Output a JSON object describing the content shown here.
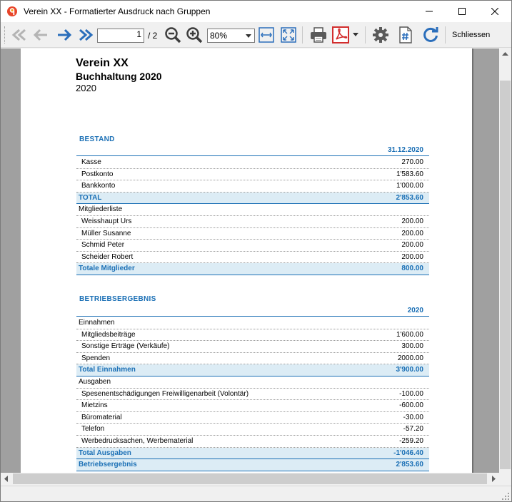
{
  "window": {
    "title": "Verein XX - Formatierter Ausdruck nach Gruppen"
  },
  "toolbar": {
    "page_current": "1",
    "page_total": "/ 2",
    "zoom": "80%",
    "close_label": "Schliessen"
  },
  "icons": {
    "first_page": "double-left-arrow",
    "prev_page": "left-arrow",
    "next_page": "right-arrow",
    "last_page": "double-right-arrow",
    "zoom_out": "zoom-out",
    "zoom_in": "zoom-in",
    "fit_width": "fit-width",
    "fit_page": "fit-page",
    "print": "printer",
    "pdf": "pdf",
    "settings": "gear",
    "page_numbers": "hash-document",
    "refresh": "refresh"
  },
  "colors": {
    "accent": "#1a6fb5",
    "total_bg": "#dcecf5",
    "pdf_red": "#d22d2d"
  },
  "report": {
    "title": "Verein XX",
    "subtitle": "Buchhaltung 2020",
    "year": "2020",
    "bestand": {
      "heading": "BESTAND",
      "column": "31.12.2020",
      "rows": [
        {
          "label": "Kasse",
          "value": "270.00",
          "kind": "item"
        },
        {
          "label": "Postkonto",
          "value": "1'583.60",
          "kind": "item"
        },
        {
          "label": "Bankkonto",
          "value": "1'000.00",
          "kind": "item"
        },
        {
          "label": "TOTAL",
          "value": "2'853.60",
          "kind": "total"
        },
        {
          "label": "Mitgliederliste",
          "value": "",
          "kind": "group"
        },
        {
          "label": "Weisshaupt Urs",
          "value": "200.00",
          "kind": "item"
        },
        {
          "label": "Müller Susanne",
          "value": "200.00",
          "kind": "item"
        },
        {
          "label": "Schmid Peter",
          "value": "200.00",
          "kind": "item"
        },
        {
          "label": "Scheider Robert",
          "value": "200.00",
          "kind": "item"
        },
        {
          "label": "Totale Mitglieder",
          "value": "800.00",
          "kind": "total"
        }
      ]
    },
    "betriebsergebnis": {
      "heading": "BETRIEBSERGEBNIS",
      "column": "2020",
      "rows": [
        {
          "label": "Einnahmen",
          "value": "",
          "kind": "group"
        },
        {
          "label": "Mitgliedsbeiträge",
          "value": "1'600.00",
          "kind": "item"
        },
        {
          "label": "Sonstige Erträge (Verkäufe)",
          "value": "300.00",
          "kind": "item"
        },
        {
          "label": "Spenden",
          "value": "2000.00",
          "kind": "item"
        },
        {
          "label": "Total Einnahmen",
          "value": "3'900.00",
          "kind": "total"
        },
        {
          "label": "Ausgaben",
          "value": "",
          "kind": "group"
        },
        {
          "label": "Spesenentschädigungen Freiwilligenarbeit (Volontär)",
          "value": "-100.00",
          "kind": "item"
        },
        {
          "label": "Mietzins",
          "value": "-600.00",
          "kind": "item"
        },
        {
          "label": "Büromaterial",
          "value": "-30.00",
          "kind": "item"
        },
        {
          "label": "Telefon",
          "value": "-57.20",
          "kind": "item"
        },
        {
          "label": "Werbedrucksachen, Werbematerial",
          "value": "-259.20",
          "kind": "item"
        },
        {
          "label": "Total Ausgaben",
          "value": "-1'046.40",
          "kind": "total"
        },
        {
          "label": "Betriebsergebnis",
          "value": "2'853.60",
          "kind": "total"
        }
      ]
    }
  }
}
